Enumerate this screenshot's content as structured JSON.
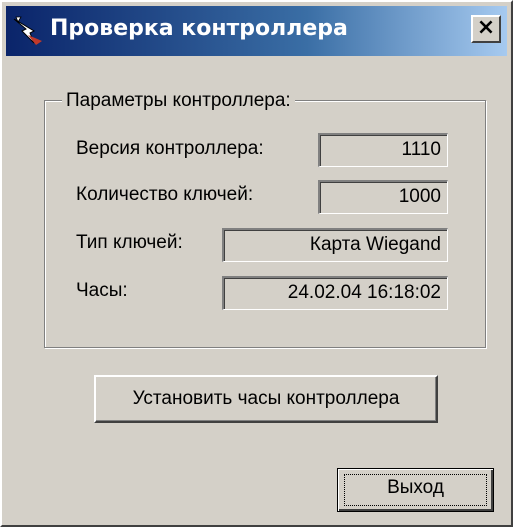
{
  "window": {
    "title": "Проверка контроллера",
    "close_label": "×",
    "colors": {
      "titlebar": "#0a246a",
      "titlebar_end": "#a6caf0",
      "face": "#d4d0c8"
    }
  },
  "group": {
    "label": "Параметры контроллера:",
    "rows": [
      {
        "label": "Версия контроллера:",
        "value": "1110"
      },
      {
        "label": "Количество ключей:",
        "value": "1000"
      },
      {
        "label": "Тип ключей:",
        "value": "Карта Wiegand"
      },
      {
        "label": "Часы:",
        "value": "24.02.04  16:18:02"
      }
    ]
  },
  "buttons": {
    "set_clock": "Установить часы контроллера",
    "exit": "Выход"
  }
}
